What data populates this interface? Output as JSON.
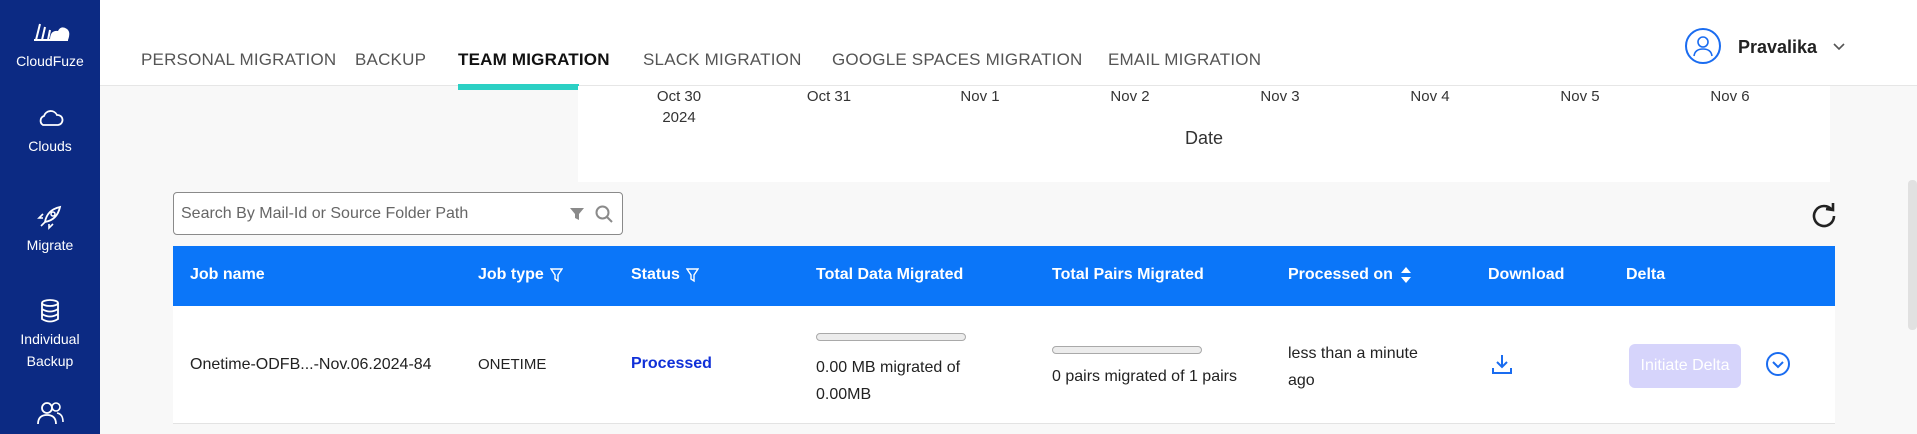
{
  "sidebar": {
    "logo_label": "CloudFuze",
    "items": [
      {
        "label": "Clouds",
        "icon": "cloud-icon"
      },
      {
        "label": "Migrate",
        "icon": "rocket-icon"
      },
      {
        "label": "Individual Backup",
        "icon": "database-icon"
      },
      {
        "label": "",
        "icon": "users-icon"
      }
    ],
    "bg_color": "#0c2a83"
  },
  "topnav": {
    "tabs": [
      {
        "label": "PERSONAL MIGRATION",
        "active": false
      },
      {
        "label": "BACKUP",
        "active": false
      },
      {
        "label": "TEAM MIGRATION",
        "active": true
      },
      {
        "label": "SLACK MIGRATION",
        "active": false
      },
      {
        "label": "GOOGLE SPACES MIGRATION",
        "active": false
      },
      {
        "label": "EMAIL MIGRATION",
        "active": false
      }
    ],
    "accent_color": "#2bd0c4",
    "user": {
      "name": "Pravalika"
    }
  },
  "chart_data": {
    "type": "line",
    "categories": [
      "Oct 30",
      "Oct 31",
      "Nov 1",
      "Nov 2",
      "Nov 3",
      "Nov 4",
      "Nov 5",
      "Nov 6"
    ],
    "year_label": "2024",
    "xlabel": "Date",
    "ylabel": "",
    "title": "",
    "series": []
  },
  "search": {
    "placeholder": "Search By Mail-Id or Source Folder Path",
    "value": ""
  },
  "table": {
    "header_color": "#0b76f9",
    "columns": [
      "Job name",
      "Job type",
      "Status",
      "Total Data Migrated",
      "Total Pairs Migrated",
      "Processed on",
      "Download",
      "Delta"
    ],
    "rows": [
      {
        "job_name": "Onetime-ODFB...-Nov.06.2024-84",
        "job_type": "ONETIME",
        "status": "Processed",
        "data_migrated_line1": "0.00 MB migrated of",
        "data_migrated_line2": "0.00MB",
        "data_progress": 0,
        "pairs_migrated": "0 pairs migrated of 1 pairs",
        "pairs_progress": 0,
        "processed_on_line1": "less than a minute",
        "processed_on_line2": "ago",
        "delta_button": "Initiate Delta"
      }
    ]
  }
}
